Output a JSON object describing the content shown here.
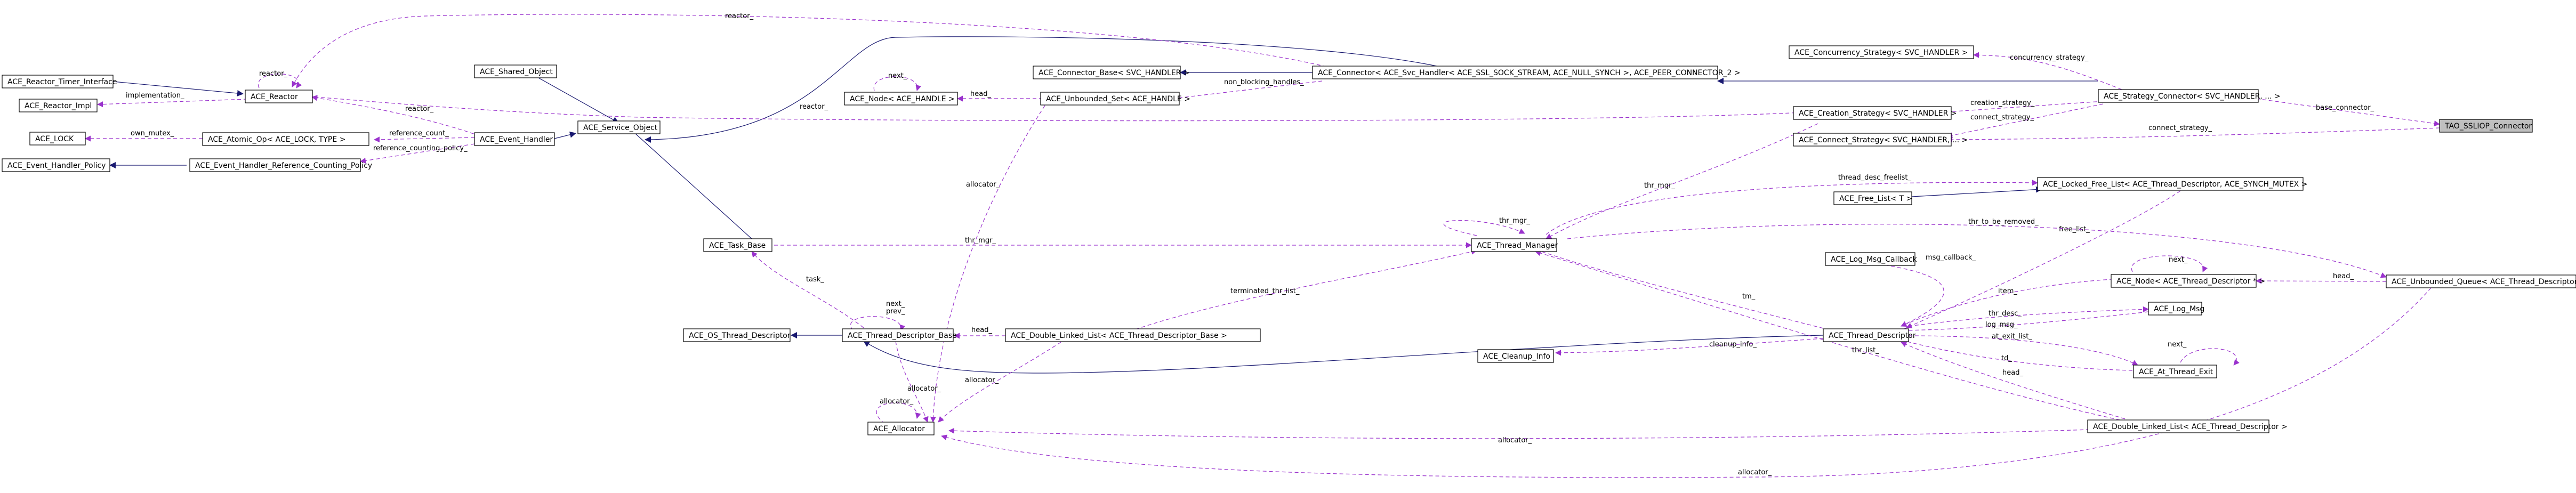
{
  "nodes": [
    {
      "id": "n_timer_iface",
      "label": "ACE_Reactor_Timer_Interface"
    },
    {
      "id": "n_reactor_impl",
      "label": "ACE_Reactor_Impl"
    },
    {
      "id": "n_reactor",
      "label": "ACE_Reactor"
    },
    {
      "id": "n_shared_obj",
      "label": "ACE_Shared_Object"
    },
    {
      "id": "n_service_obj",
      "label": "ACE_Service_Object"
    },
    {
      "id": "n_event_handler",
      "label": "ACE_Event_Handler"
    },
    {
      "id": "n_lock",
      "label": "ACE_LOCK"
    },
    {
      "id": "n_atomic",
      "label": "ACE_Atomic_Op< ACE_LOCK, TYPE >"
    },
    {
      "id": "n_eh_policy",
      "label": "ACE_Event_Handler_Policy"
    },
    {
      "id": "n_eh_refpolicy",
      "label": "ACE_Event_Handler_Reference_Counting_Policy"
    },
    {
      "id": "n_node_handle",
      "label": "ACE_Node< ACE_HANDLE >"
    },
    {
      "id": "n_conn_base",
      "label": "ACE_Connector_Base< SVC_HANDLER >"
    },
    {
      "id": "n_unb_set",
      "label": "ACE_Unbounded_Set< ACE_HANDLE >"
    },
    {
      "id": "n_connector",
      "label": "ACE_Connector< ACE_Svc_Handler< ACE_SSL_SOCK_STREAM, ACE_NULL_SYNCH >, ACE_PEER_CONNECTOR_2 >"
    },
    {
      "id": "n_conc_strat",
      "label": "ACE_Concurrency_Strategy< SVC_HANDLER >"
    },
    {
      "id": "n_strat_conn",
      "label": "ACE_Strategy_Connector< SVC_HANDLER, ... >"
    },
    {
      "id": "n_creation",
      "label": "ACE_Creation_Strategy< SVC_HANDLER >"
    },
    {
      "id": "n_connect_strat",
      "label": "ACE_Connect_Strategy< SVC_HANDLER, ... >"
    },
    {
      "id": "n_tao",
      "label": "TAO_SSLIOP_Connector"
    },
    {
      "id": "n_task_base",
      "label": "ACE_Task_Base"
    },
    {
      "id": "n_thr_mgr",
      "label": "ACE_Thread_Manager"
    },
    {
      "id": "n_locked_free",
      "label": "ACE_Locked_Free_List< ACE_Thread_Descriptor, ACE_SYNCH_MUTEX >"
    },
    {
      "id": "n_free_list",
      "label": "ACE_Free_List< T >"
    },
    {
      "id": "n_log_cb",
      "label": "ACE_Log_Msg_Callback"
    },
    {
      "id": "n_node_td",
      "label": "ACE_Node< ACE_Thread_Descriptor * >"
    },
    {
      "id": "n_log_msg",
      "label": "ACE_Log_Msg"
    },
    {
      "id": "n_unb_queue",
      "label": "ACE_Unbounded_Queue< ACE_Thread_Descriptor * >"
    },
    {
      "id": "n_os_td",
      "label": "ACE_OS_Thread_Descriptor"
    },
    {
      "id": "n_td_base",
      "label": "ACE_Thread_Descriptor_Base"
    },
    {
      "id": "n_dll_tdb",
      "label": "ACE_Double_Linked_List< ACE_Thread_Descriptor_Base >"
    },
    {
      "id": "n_td",
      "label": "ACE_Thread_Descriptor"
    },
    {
      "id": "n_cleanup",
      "label": "ACE_Cleanup_Info"
    },
    {
      "id": "n_at_exit",
      "label": "ACE_At_Thread_Exit"
    },
    {
      "id": "n_allocator",
      "label": "ACE_Allocator"
    },
    {
      "id": "n_dll_td",
      "label": "ACE_Double_Linked_List< ACE_Thread_Descriptor >"
    }
  ],
  "edges": [
    {
      "id": "e_timer_reactor",
      "kind": "inherit",
      "label": ""
    },
    {
      "id": "e_impl_reactor",
      "kind": "use",
      "label": "implementation_"
    },
    {
      "id": "e_reactor_self",
      "kind": "use",
      "label": "reactor_"
    },
    {
      "id": "e_shared_service",
      "kind": "inherit",
      "label": ""
    },
    {
      "id": "e_event_service",
      "kind": "inherit",
      "label": ""
    },
    {
      "id": "e_reactor_event",
      "kind": "use",
      "label": "reactor_"
    },
    {
      "id": "e_lock_atomic",
      "kind": "use",
      "label": "own_mutex_"
    },
    {
      "id": "e_atomic_event",
      "kind": "use",
      "label": "reference_count_"
    },
    {
      "id": "e_policy_ref",
      "kind": "inherit",
      "label": ""
    },
    {
      "id": "e_ref_event",
      "kind": "use",
      "label": "reference_counting_policy_"
    },
    {
      "id": "e_node_self",
      "kind": "use",
      "label": "next_"
    },
    {
      "id": "e_node_unbset",
      "kind": "use",
      "label": "head_"
    },
    {
      "id": "e_connbase_conn",
      "kind": "inherit",
      "label": ""
    },
    {
      "id": "e_unbset_conn",
      "kind": "use",
      "label": "non_blocking_handles_"
    },
    {
      "id": "e_service_conn",
      "kind": "inherit",
      "label": ""
    },
    {
      "id": "e_conn_strat",
      "kind": "inherit",
      "label": ""
    },
    {
      "id": "e_reactor_connector",
      "kind": "use",
      "label": "reactor_"
    },
    {
      "id": "e_reactor_top",
      "kind": "use",
      "label": "reactor_"
    },
    {
      "id": "e_reactor_creation",
      "kind": "use",
      "label": "reactor_"
    },
    {
      "id": "e_conc_strat",
      "kind": "use",
      "label": "concurrency_strategy_"
    },
    {
      "id": "e_creation_strat",
      "kind": "use",
      "label": "creation_strategy_"
    },
    {
      "id": "e_connect_strat",
      "kind": "use",
      "label": "connect_strategy_"
    },
    {
      "id": "e_strat_tao",
      "kind": "use",
      "label": "base_connector_"
    },
    {
      "id": "e_connect_tao",
      "kind": "use",
      "label": "connect_strategy_"
    },
    {
      "id": "e_service_task",
      "kind": "inherit",
      "label": ""
    },
    {
      "id": "e_task_thrmgr",
      "kind": "use",
      "label": "thr_mgr_"
    },
    {
      "id": "e_thrmgr_task",
      "kind": "use",
      "label": "thr_mgr_"
    },
    {
      "id": "e_thrmgr_self",
      "kind": "use",
      "label": "thr_mgr_"
    },
    {
      "id": "e_thrmgr_creation",
      "kind": "use",
      "label": "thr_mgr_"
    },
    {
      "id": "e_locked_thrmgr",
      "kind": "use",
      "label": "thread_desc_freelist_"
    },
    {
      "id": "e_freelist_locked",
      "kind": "inherit",
      "label": ""
    },
    {
      "id": "e_td_locked",
      "kind": "use",
      "label": "free_list_"
    },
    {
      "id": "e_queue_thrmgr",
      "kind": "use",
      "label": "thr_to_be_removed_"
    },
    {
      "id": "e_node_queue",
      "kind": "use",
      "label": "head_"
    },
    {
      "id": "e_td_node",
      "kind": "use",
      "label": "item_"
    },
    {
      "id": "e_node_td_self",
      "kind": "use",
      "label": "next_"
    },
    {
      "id": "e_logcb_td",
      "kind": "use",
      "label": "msg_callback_"
    },
    {
      "id": "e_td_logmsg",
      "kind": "use",
      "label": "thr_desc_"
    },
    {
      "id": "e_logmsg_td",
      "kind": "use",
      "label": "log_msg_"
    },
    {
      "id": "e_thrmgr_td",
      "kind": "use",
      "label": "tm_"
    },
    {
      "id": "e_osd_tdb",
      "kind": "inherit",
      "label": ""
    },
    {
      "id": "e_tdb_td",
      "kind": "inherit",
      "label": ""
    },
    {
      "id": "e_tdb_self",
      "kind": "use",
      "label": "next_\nprev_"
    },
    {
      "id": "e_tdb_dll",
      "kind": "use",
      "label": "head_"
    },
    {
      "id": "e_dll_thrmgr",
      "kind": "use",
      "label": "terminated_thr_list_"
    },
    {
      "id": "e_td_task",
      "kind": "use",
      "label": "task_"
    },
    {
      "id": "e_cleanup_td",
      "kind": "use",
      "label": "cleanup_info_"
    },
    {
      "id": "e_atexit_td",
      "kind": "use",
      "label": "at_exit_list_"
    },
    {
      "id": "e_td_atexit",
      "kind": "use",
      "label": "td_"
    },
    {
      "id": "e_atexit_self",
      "kind": "use",
      "label": "next_"
    },
    {
      "id": "e_td_dlltd",
      "kind": "use",
      "label": "head_"
    },
    {
      "id": "e_dlltd_thrmgr",
      "kind": "use",
      "label": "thr_list_"
    },
    {
      "id": "e_alloc_td",
      "kind": "use",
      "label": "allocator_"
    },
    {
      "id": "e_alloc_self",
      "kind": "use",
      "label": "allocator_"
    },
    {
      "id": "e_alloc_tdb",
      "kind": "use",
      "label": "allocator_"
    },
    {
      "id": "e_alloc_dlltdb",
      "kind": "use",
      "label": "allocator_"
    },
    {
      "id": "e_alloc_dlltd",
      "kind": "use",
      "label": "allocator_"
    },
    {
      "id": "e_alloc_queue",
      "kind": "use",
      "label": "allocator_"
    }
  ]
}
